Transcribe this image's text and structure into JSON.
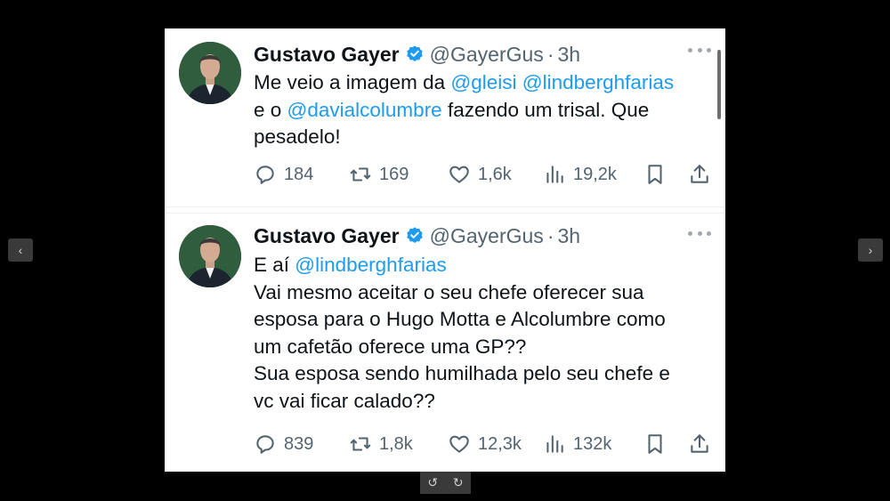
{
  "viewer": {
    "prev_icon": "‹",
    "next_icon": "›",
    "rotate_left_icon": "↺",
    "rotate_right_icon": "↻"
  },
  "tweets": [
    {
      "name": "Gustavo Gayer",
      "handle": "@GayerGus",
      "dot": "·",
      "time": "3h",
      "body_lines": [
        [
          "Me veio a imagem da ",
          "@gleisi",
          " ",
          "@lindberghfarias"
        ],
        [
          "e o ",
          "@davialcolumbre",
          " fazendo um trisal. Que"
        ],
        [
          "pesadelo!"
        ]
      ],
      "replies": "184",
      "reposts": "169",
      "likes": "1,6k",
      "views": "19,2k"
    },
    {
      "name": "Gustavo Gayer",
      "handle": "@GayerGus",
      "dot": "·",
      "time": "3h",
      "line1_prefix": "E aí ",
      "line1_mention": "@lindberghfarias",
      "line2": "Vai mesmo aceitar o seu chefe oferecer sua",
      "line3": "esposa para o Hugo Motta e Alcolumbre como",
      "line4": "um cafetão oferece uma GP??",
      "line5": "Sua esposa sendo humilhada pelo seu chefe e",
      "line6": "vc vai ficar calado??",
      "replies": "839",
      "reposts": "1,8k",
      "likes": "12,3k",
      "views": "132k"
    }
  ],
  "colors": {
    "mention": "#1d9bf0",
    "text": "#0f1419",
    "muted": "#536471",
    "verified": "#1d9bf0"
  }
}
